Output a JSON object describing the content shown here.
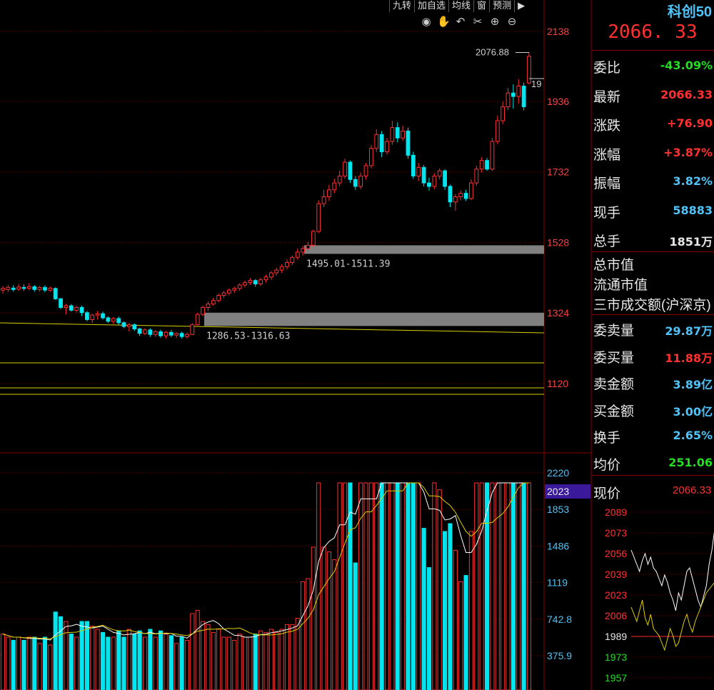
{
  "toolbar": {
    "buttons": [
      "九转",
      "加自选",
      "均线",
      "窗",
      "预测"
    ],
    "icons": [
      "eye-icon",
      "hand-icon",
      "undo-icon",
      "scissors-icon",
      "zoom-in-icon",
      "zoom-out-icon"
    ]
  },
  "kline": {
    "price_axis": [
      "2138",
      "1936",
      "1732",
      "1528",
      "1324",
      "1120"
    ],
    "high_label": "2076.88",
    "right_edge_label": "19",
    "zones": [
      {
        "label": "1495.01-1511.39",
        "low": 1495.01,
        "high": 1511.39
      },
      {
        "label": "1286.53-1316.63",
        "low": 1286.53,
        "high": 1316.63
      }
    ]
  },
  "volume": {
    "axis": [
      "2220",
      "1853",
      "1486",
      "1119",
      "742.8",
      "375.9"
    ],
    "current_label": "2023"
  },
  "panel": {
    "title": "科创50",
    "price": "2066. 33",
    "rows": [
      {
        "k": "委比",
        "v": "-43.09%",
        "c": "#22dd22"
      },
      {
        "k": "最新",
        "v": "2066.33",
        "c": "#ff3030"
      },
      {
        "k": "涨跌",
        "v": "+76.90",
        "c": "#ff3030"
      },
      {
        "k": "涨幅",
        "v": "+3.87%",
        "c": "#ff3030"
      },
      {
        "k": "振幅",
        "v": "3.82%",
        "c": "#4fc3f7"
      },
      {
        "k": "现手",
        "v": "58883",
        "c": "#4fc3f7"
      },
      {
        "k": "总手",
        "v": "1851万",
        "c": "#e8e8e8"
      }
    ],
    "texts": [
      "总市值",
      "流通市值",
      "三市成交额(沪深京)"
    ],
    "rows2": [
      {
        "k": "委卖量",
        "v": "29.87万",
        "c": "#4fc3f7"
      },
      {
        "k": "委买量",
        "v": "11.88万",
        "c": "#ff3030"
      },
      {
        "k": "卖金额",
        "v": "3.89亿",
        "c": "#4fc3f7"
      },
      {
        "k": "买金额",
        "v": "3.00亿",
        "c": "#4fc3f7"
      },
      {
        "k": "换手",
        "v": "2.65%",
        "c": "#4fc3f7"
      },
      {
        "k": "均价",
        "v": "251.06",
        "c": "#22dd22"
      }
    ],
    "now_label": "现价",
    "now_value": "2066.33",
    "mini_axis": [
      "2089",
      "2073",
      "2056",
      "2039",
      "2023",
      "2006",
      "1989",
      "1973",
      "1957"
    ]
  },
  "chart_data": {
    "type": "candlestick",
    "ylim": [
      1120,
      2138
    ],
    "candles": [
      [
        1390,
        1395,
        1380,
        1402
      ],
      [
        1392,
        1398,
        1385,
        1405
      ],
      [
        1396,
        1392,
        1386,
        1404
      ],
      [
        1393,
        1399,
        1388,
        1408
      ],
      [
        1398,
        1395,
        1388,
        1406
      ],
      [
        1395,
        1400,
        1390,
        1410
      ],
      [
        1400,
        1392,
        1385,
        1405
      ],
      [
        1392,
        1398,
        1386,
        1402
      ],
      [
        1398,
        1390,
        1384,
        1404
      ],
      [
        1390,
        1396,
        1385,
        1400
      ],
      [
        1395,
        1365,
        1362,
        1398
      ],
      [
        1365,
        1340,
        1335,
        1368
      ],
      [
        1340,
        1345,
        1320,
        1350
      ],
      [
        1345,
        1332,
        1328,
        1350
      ],
      [
        1332,
        1340,
        1325,
        1345
      ],
      [
        1340,
        1325,
        1315,
        1345
      ],
      [
        1325,
        1305,
        1300,
        1330
      ],
      [
        1305,
        1318,
        1295,
        1322
      ],
      [
        1318,
        1322,
        1305,
        1330
      ],
      [
        1322,
        1310,
        1305,
        1328
      ],
      [
        1310,
        1300,
        1295,
        1315
      ],
      [
        1300,
        1308,
        1292,
        1312
      ],
      [
        1308,
        1296,
        1290,
        1314
      ],
      [
        1296,
        1285,
        1280,
        1300
      ],
      [
        1285,
        1290,
        1270,
        1295
      ],
      [
        1290,
        1278,
        1272,
        1294
      ],
      [
        1278,
        1265,
        1258,
        1282
      ],
      [
        1265,
        1275,
        1260,
        1280
      ],
      [
        1275,
        1262,
        1255,
        1280
      ],
      [
        1262,
        1270,
        1255,
        1275
      ],
      [
        1270,
        1258,
        1252,
        1276
      ],
      [
        1258,
        1268,
        1250,
        1272
      ],
      [
        1268,
        1260,
        1254,
        1275
      ],
      [
        1260,
        1265,
        1252,
        1268
      ],
      [
        1265,
        1256,
        1250,
        1270
      ],
      [
        1256,
        1262,
        1250,
        1268
      ],
      [
        1262,
        1290,
        1260,
        1295
      ],
      [
        1290,
        1320,
        1288,
        1325
      ],
      [
        1320,
        1340,
        1315,
        1345
      ],
      [
        1340,
        1350,
        1330,
        1358
      ],
      [
        1350,
        1360,
        1345,
        1368
      ],
      [
        1360,
        1375,
        1355,
        1380
      ],
      [
        1375,
        1382,
        1368,
        1388
      ],
      [
        1382,
        1390,
        1375,
        1395
      ],
      [
        1390,
        1395,
        1382,
        1400
      ],
      [
        1395,
        1405,
        1388,
        1410
      ],
      [
        1405,
        1412,
        1398,
        1418
      ],
      [
        1412,
        1418,
        1405,
        1425
      ],
      [
        1418,
        1408,
        1400,
        1422
      ],
      [
        1408,
        1420,
        1402,
        1426
      ],
      [
        1420,
        1428,
        1412,
        1435
      ],
      [
        1428,
        1440,
        1420,
        1445
      ],
      [
        1440,
        1448,
        1432,
        1455
      ],
      [
        1448,
        1458,
        1440,
        1465
      ],
      [
        1458,
        1470,
        1450,
        1478
      ],
      [
        1470,
        1485,
        1462,
        1490
      ],
      [
        1485,
        1500,
        1478,
        1510
      ],
      [
        1500,
        1510,
        1490,
        1518
      ],
      [
        1510,
        1520,
        1500,
        1530
      ],
      [
        1520,
        1560,
        1515,
        1565
      ],
      [
        1560,
        1640,
        1555,
        1650
      ],
      [
        1640,
        1660,
        1630,
        1680
      ],
      [
        1660,
        1680,
        1648,
        1695
      ],
      [
        1680,
        1700,
        1670,
        1712
      ],
      [
        1700,
        1720,
        1690,
        1735
      ],
      [
        1720,
        1760,
        1712,
        1770
      ],
      [
        1760,
        1710,
        1700,
        1765
      ],
      [
        1710,
        1690,
        1680,
        1720
      ],
      [
        1690,
        1720,
        1682,
        1730
      ],
      [
        1720,
        1750,
        1710,
        1758
      ],
      [
        1750,
        1800,
        1742,
        1810
      ],
      [
        1800,
        1840,
        1790,
        1855
      ],
      [
        1840,
        1790,
        1775,
        1850
      ],
      [
        1790,
        1820,
        1782,
        1830
      ],
      [
        1820,
        1860,
        1810,
        1880
      ],
      [
        1860,
        1830,
        1818,
        1875
      ],
      [
        1830,
        1850,
        1822,
        1865
      ],
      [
        1850,
        1780,
        1770,
        1860
      ],
      [
        1780,
        1720,
        1712,
        1790
      ],
      [
        1720,
        1745,
        1705,
        1758
      ],
      [
        1745,
        1700,
        1690,
        1752
      ],
      [
        1700,
        1690,
        1678,
        1715
      ],
      [
        1690,
        1720,
        1682,
        1728
      ],
      [
        1720,
        1735,
        1710,
        1742
      ],
      [
        1735,
        1690,
        1680,
        1740
      ],
      [
        1690,
        1645,
        1630,
        1695
      ],
      [
        1645,
        1660,
        1620,
        1668
      ],
      [
        1660,
        1670,
        1650,
        1678
      ],
      [
        1670,
        1655,
        1648,
        1680
      ],
      [
        1655,
        1700,
        1650,
        1710
      ],
      [
        1700,
        1740,
        1692,
        1750
      ],
      [
        1740,
        1765,
        1730,
        1775
      ],
      [
        1765,
        1740,
        1735,
        1772
      ],
      [
        1740,
        1820,
        1735,
        1830
      ],
      [
        1820,
        1880,
        1812,
        1895
      ],
      [
        1880,
        1920,
        1870,
        1935
      ],
      [
        1920,
        1960,
        1910,
        1975
      ],
      [
        1960,
        1950,
        1915,
        1985
      ],
      [
        1950,
        1980,
        1930,
        2000
      ],
      [
        1980,
        1920,
        1910,
        1990
      ],
      [
        1989,
        2066,
        1985,
        2077
      ]
    ]
  }
}
